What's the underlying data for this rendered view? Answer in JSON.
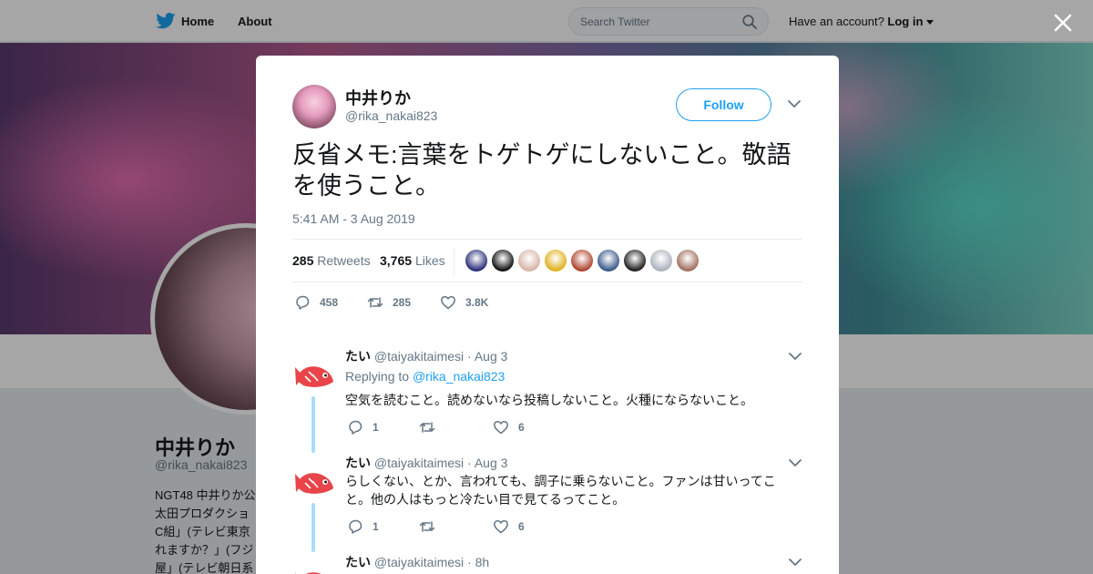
{
  "topnav": {
    "home_label": "Home",
    "about_label": "About",
    "search_placeholder": "Search Twitter",
    "account_prompt": "Have an account?",
    "login_label": "Log in"
  },
  "background_profile": {
    "name": "中井りか",
    "handle": "@rika_nakai823",
    "bio": "NGT48 中井りか公\n太田プロダクショ\nC組」(テレビ東京\nれますか？」(フジ\n屋」(テレビ朝日系"
  },
  "tweet": {
    "author_name": "中井りか",
    "author_handle": "@rika_nakai823",
    "follow_label": "Follow",
    "text": "反省メモ:言葉をトゲトゲにしないこと。敬語を使うこと。",
    "timestamp": "5:41 AM - 3 Aug 2019",
    "retweets_count": "285",
    "retweets_label": "Retweets",
    "likes_count": "3,765",
    "likes_label": "Likes",
    "liker_colors": [
      "#2a2f7a",
      "#111111",
      "#d8b4a6",
      "#e0b020",
      "#b0442e",
      "#3b5a8a",
      "#1f1f1f",
      "#aab2bd",
      "#a07060"
    ],
    "actions": {
      "replies": "458",
      "retweets": "285",
      "likes": "3.8K"
    }
  },
  "replies": [
    {
      "name": "たい",
      "handle": "@taiyakitaimesi",
      "separator": "·",
      "date": "Aug 3",
      "replying_prefix": "Replying to",
      "replying_to": "@rika_nakai823",
      "text": "空気を読むこと。読めないなら投稿しないこと。火種にならないこと。",
      "reply_count": "1",
      "like_count": "6"
    },
    {
      "name": "たい",
      "handle": "@taiyakitaimesi",
      "separator": "·",
      "date": "Aug 3",
      "text": "らしくない、とか、言われても、調子に乗らないこと。ファンは甘いってこと。他の人はもっと冷たい目で見てるってこと。",
      "reply_count": "1",
      "like_count": "6"
    },
    {
      "name": "たい",
      "handle": "@taiyakitaimesi",
      "separator": "·",
      "date": "8h"
    }
  ],
  "colors": {
    "accent": "#1da1f2",
    "thread_line": "#a8ddfb",
    "muted": "#657786"
  }
}
